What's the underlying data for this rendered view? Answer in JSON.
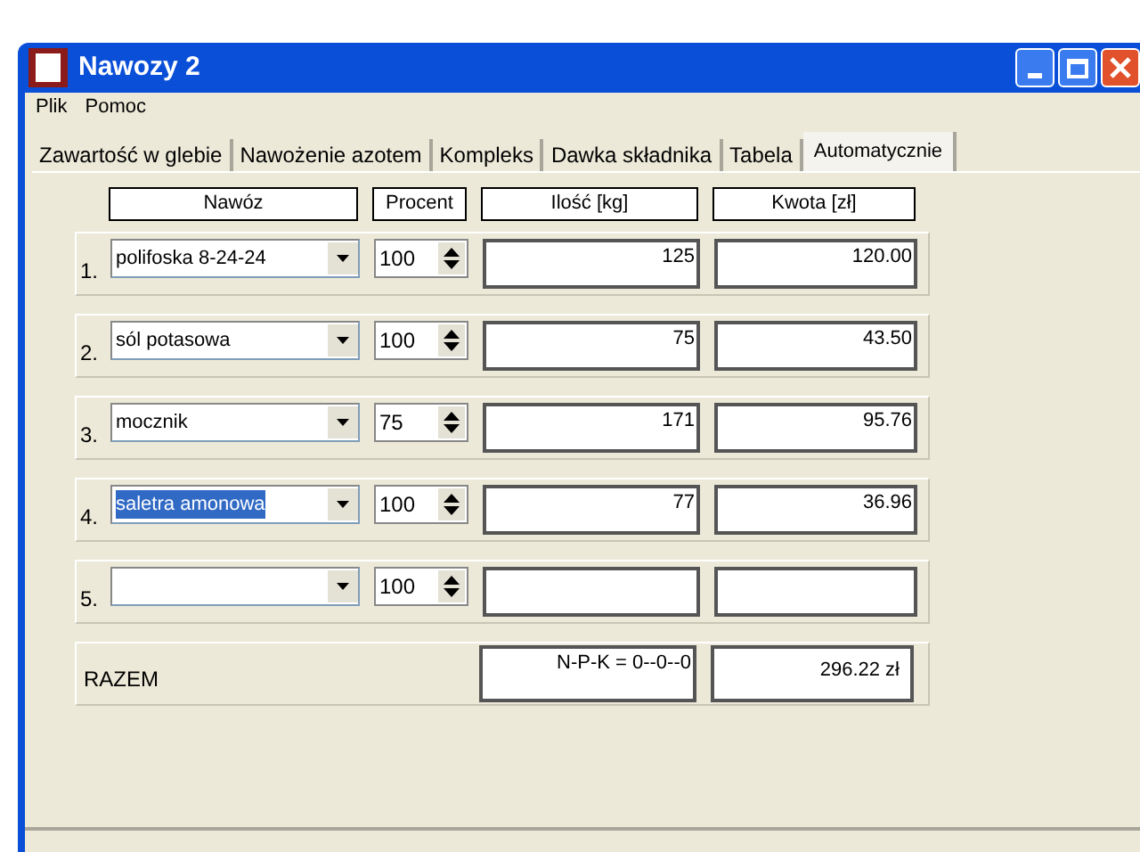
{
  "window": {
    "title": "Nawozy 2"
  },
  "menu": [
    "Plik",
    "Pomoc"
  ],
  "tabs": [
    {
      "label": "Zawartość w glebie",
      "selected": false
    },
    {
      "label": "Nawożenie azotem",
      "selected": false
    },
    {
      "label": "Kompleks",
      "selected": false
    },
    {
      "label": "Dawka składnika",
      "selected": false
    },
    {
      "label": "Tabela",
      "selected": false
    },
    {
      "label": "Automatycznie",
      "selected": true
    }
  ],
  "columns": [
    "Nawóz",
    "Procent",
    "Ilość [kg]",
    "Kwota [zł]"
  ],
  "rows": [
    {
      "number": "1.",
      "fertilizer": "polifoska 8-24-24",
      "percent": "100",
      "amount": "125",
      "cost": "120.00"
    },
    {
      "number": "2.",
      "fertilizer": "sól potasowa",
      "percent": "100",
      "amount": "75",
      "cost": "43.50"
    },
    {
      "number": "3.",
      "fertilizer": "mocznik",
      "percent": "75",
      "amount": "171",
      "cost": "95.76"
    },
    {
      "number": "4.",
      "fertilizer": "saletra amonowa",
      "text_selected": true,
      "percent": "100",
      "amount": "77",
      "cost": "36.96"
    },
    {
      "number": "5.",
      "fertilizer": "",
      "percent": "100",
      "amount": "",
      "cost": ""
    }
  ],
  "total": {
    "label": "RAZEM",
    "npk": "N-P-K = 0--0--0",
    "cost": "296.22 zł"
  }
}
